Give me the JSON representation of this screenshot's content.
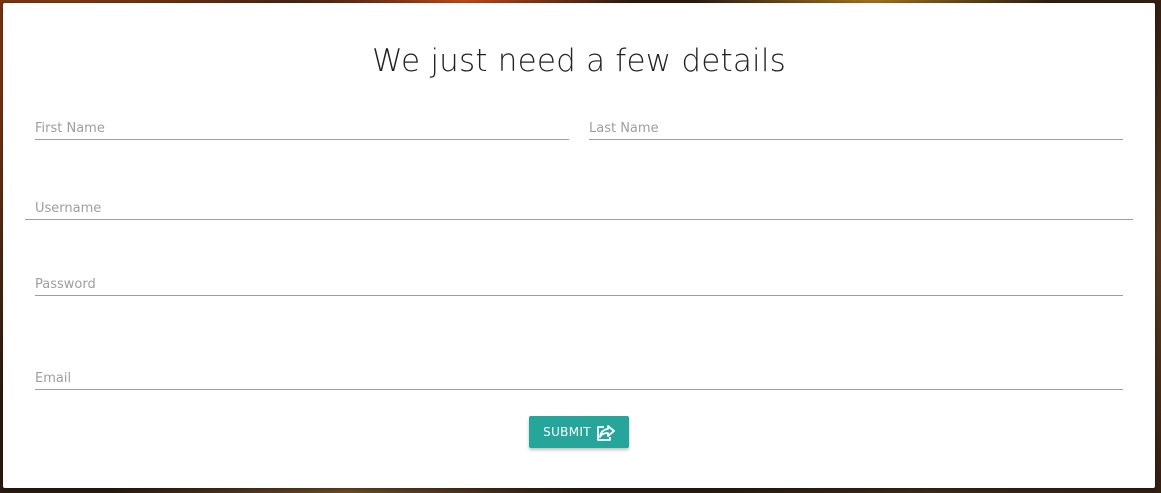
{
  "form": {
    "title": "We just need a few details",
    "fields": {
      "first_name": {
        "placeholder": "First Name",
        "value": ""
      },
      "last_name": {
        "placeholder": "Last Name",
        "value": ""
      },
      "username": {
        "placeholder": "Username",
        "value": ""
      },
      "password": {
        "placeholder": "Password",
        "value": ""
      },
      "email": {
        "placeholder": "Email",
        "value": ""
      }
    },
    "submit_label": "SUBMIT",
    "submit_icon": "share-square-icon"
  },
  "colors": {
    "accent": "#26a69a",
    "underline": "#9e9e9e",
    "placeholder": "#9e9e9e",
    "title": "#222222"
  }
}
